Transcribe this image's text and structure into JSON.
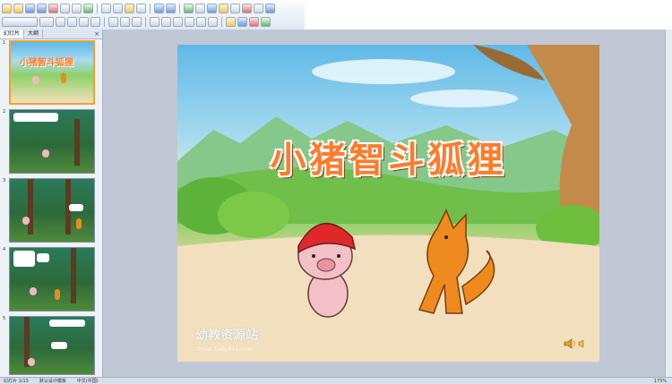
{
  "sidebar": {
    "tabs": [
      "幻灯片",
      "大纲"
    ],
    "close_glyph": "×",
    "slides": [
      {
        "num": "1"
      },
      {
        "num": "2"
      },
      {
        "num": "3"
      },
      {
        "num": "4"
      },
      {
        "num": "5"
      }
    ]
  },
  "slide": {
    "title": "小猪智斗狐狸",
    "watermark": "幼教资源站",
    "watermark_url": "zyuan.baby611.com",
    "sound_icon": "speaker-icon"
  },
  "status": {
    "slide_info": "幻灯片 1/13",
    "theme": "默认设计模板",
    "lang": "中文(中国)",
    "zoom": "175%"
  },
  "colors": {
    "title": "#ff7b2a",
    "selected_border": "#f0a030"
  }
}
